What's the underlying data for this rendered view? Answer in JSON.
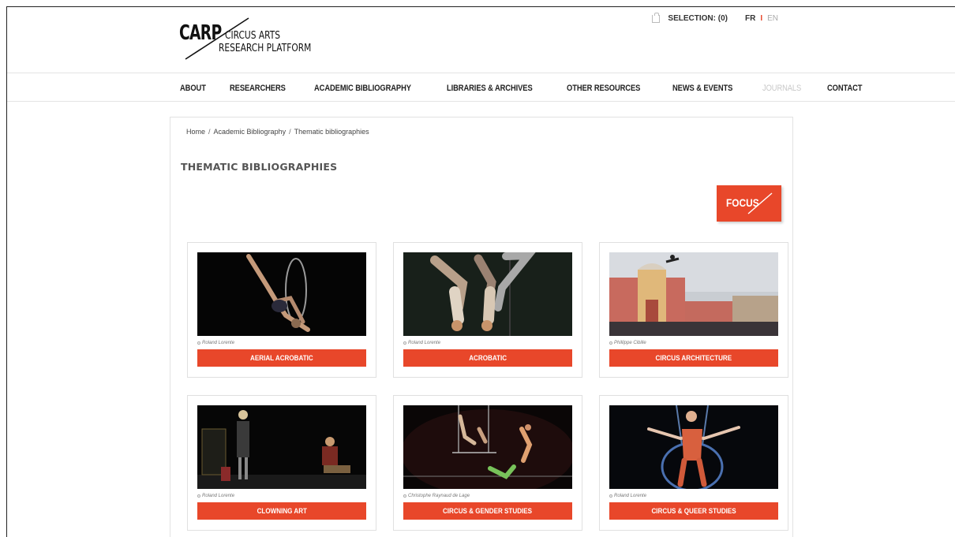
{
  "logo": {
    "mark": "CARP",
    "line1": "CIRCUS ARTS",
    "line2": "RESEARCH PLATFORM"
  },
  "topbar": {
    "selection": "SELECTION: (0)",
    "lang_fr": "FR",
    "lang_sep": "I",
    "lang_en": "EN",
    "icon": "bag-icon"
  },
  "nav": {
    "items": [
      {
        "label": "ABOUT",
        "active": true
      },
      {
        "label": "RESEARCHERS",
        "active": true
      },
      {
        "label": "ACADEMIC BIBLIOGRAPHY",
        "active": true
      },
      {
        "label": "LIBRARIES & ARCHIVES",
        "active": true
      },
      {
        "label": "OTHER RESOURCES",
        "active": true
      },
      {
        "label": "NEWS & EVENTS",
        "active": true
      },
      {
        "label": "JOURNALS",
        "active": false
      },
      {
        "label": "CONTACT",
        "active": true
      }
    ]
  },
  "breadcrumb": {
    "items": [
      "Home",
      "Academic Bibliography",
      "Thematic bibliographies"
    ],
    "separator": "/"
  },
  "page": {
    "title": "THEMATIC BIBLIOGRAPHIES",
    "focus_label": "FOCUS"
  },
  "cards": [
    {
      "credit": "Roland Lorente",
      "label": "AERIAL ACROBATIC"
    },
    {
      "credit": "Roland Lorente",
      "label": "ACROBATIC"
    },
    {
      "credit": "Phillippe Cibille",
      "label": "CIRCUS ARCHITECTURE"
    },
    {
      "credit": "Roland Lorente",
      "label": "CLOWNING ART"
    },
    {
      "credit": "Christophe Raynaud de Lage",
      "label": "CIRCUS & GENDER STUDIES"
    },
    {
      "credit": "Roland Lorente",
      "label": "CIRCUS & QUEER STUDIES"
    }
  ],
  "colors": {
    "accent": "#e8472a",
    "text": "#222222",
    "muted": "#c8c8c8",
    "border": "#e0e0e0"
  }
}
